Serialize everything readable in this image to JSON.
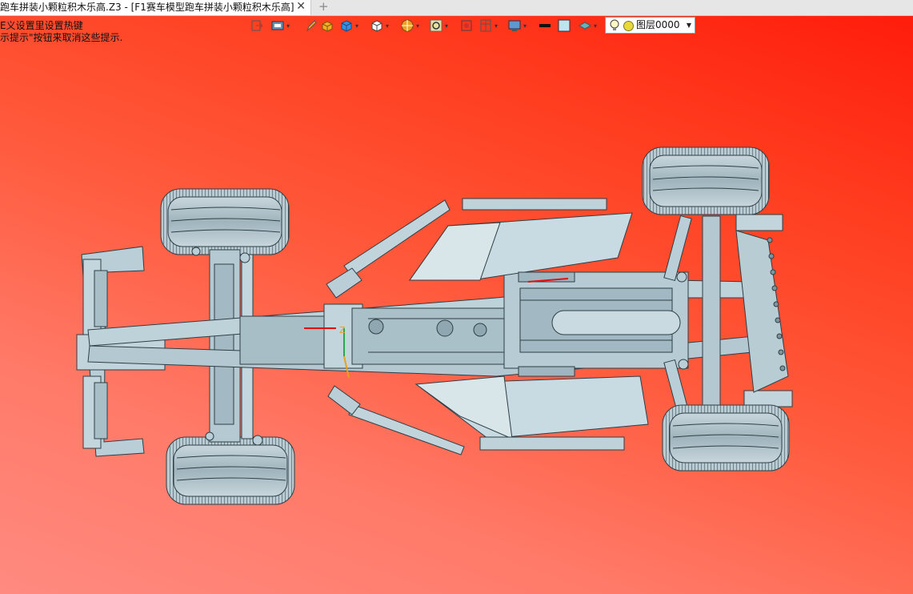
{
  "tab": {
    "title": "跑车拼装小颗粒积木乐高.Z3 - [F1赛车模型跑车拼装小颗粒积木乐高]",
    "close_glyph": "✕",
    "new_tab_glyph": "+"
  },
  "hints": {
    "line1": "E义设置里设置热键",
    "line2": "示提示\"按钮来取消这些提示."
  },
  "toolbar": {
    "items": [
      {
        "name": "exit-sketch-icon",
        "has_caret": false
      },
      {
        "name": "view-mode-icon",
        "has_caret": true
      },
      {
        "name": "pen-icon",
        "has_caret": false
      },
      {
        "name": "shaded-solid-icon",
        "has_caret": false
      },
      {
        "name": "cube-blue-icon",
        "has_caret": true
      },
      {
        "name": "cube-white-icon",
        "has_caret": true
      },
      {
        "name": "render-style-icon",
        "has_caret": true
      },
      {
        "name": "zoom-view-icon",
        "has_caret": true
      },
      {
        "name": "fit-view-icon",
        "has_caret": false
      },
      {
        "name": "section-view-icon",
        "has_caret": true
      },
      {
        "name": "display-settings-icon",
        "has_caret": true
      },
      {
        "name": "line-color-icon",
        "has_caret": false
      },
      {
        "name": "face-color-icon",
        "has_caret": false
      },
      {
        "name": "material-icon",
        "has_caret": true
      }
    ],
    "colors": {
      "line_color": "#111111",
      "face_color": "#bfe3f0"
    }
  },
  "layer": {
    "value": "图层0000",
    "bulb_icon": "light-bulb-icon",
    "color": "#e8d83a"
  },
  "viewport": {
    "background_top": "#ff1a0a",
    "background_bottom": "#ff8a80",
    "model_color": "#b6cdd6",
    "model_outline": "#3a4a52",
    "axis_label": "Z"
  }
}
